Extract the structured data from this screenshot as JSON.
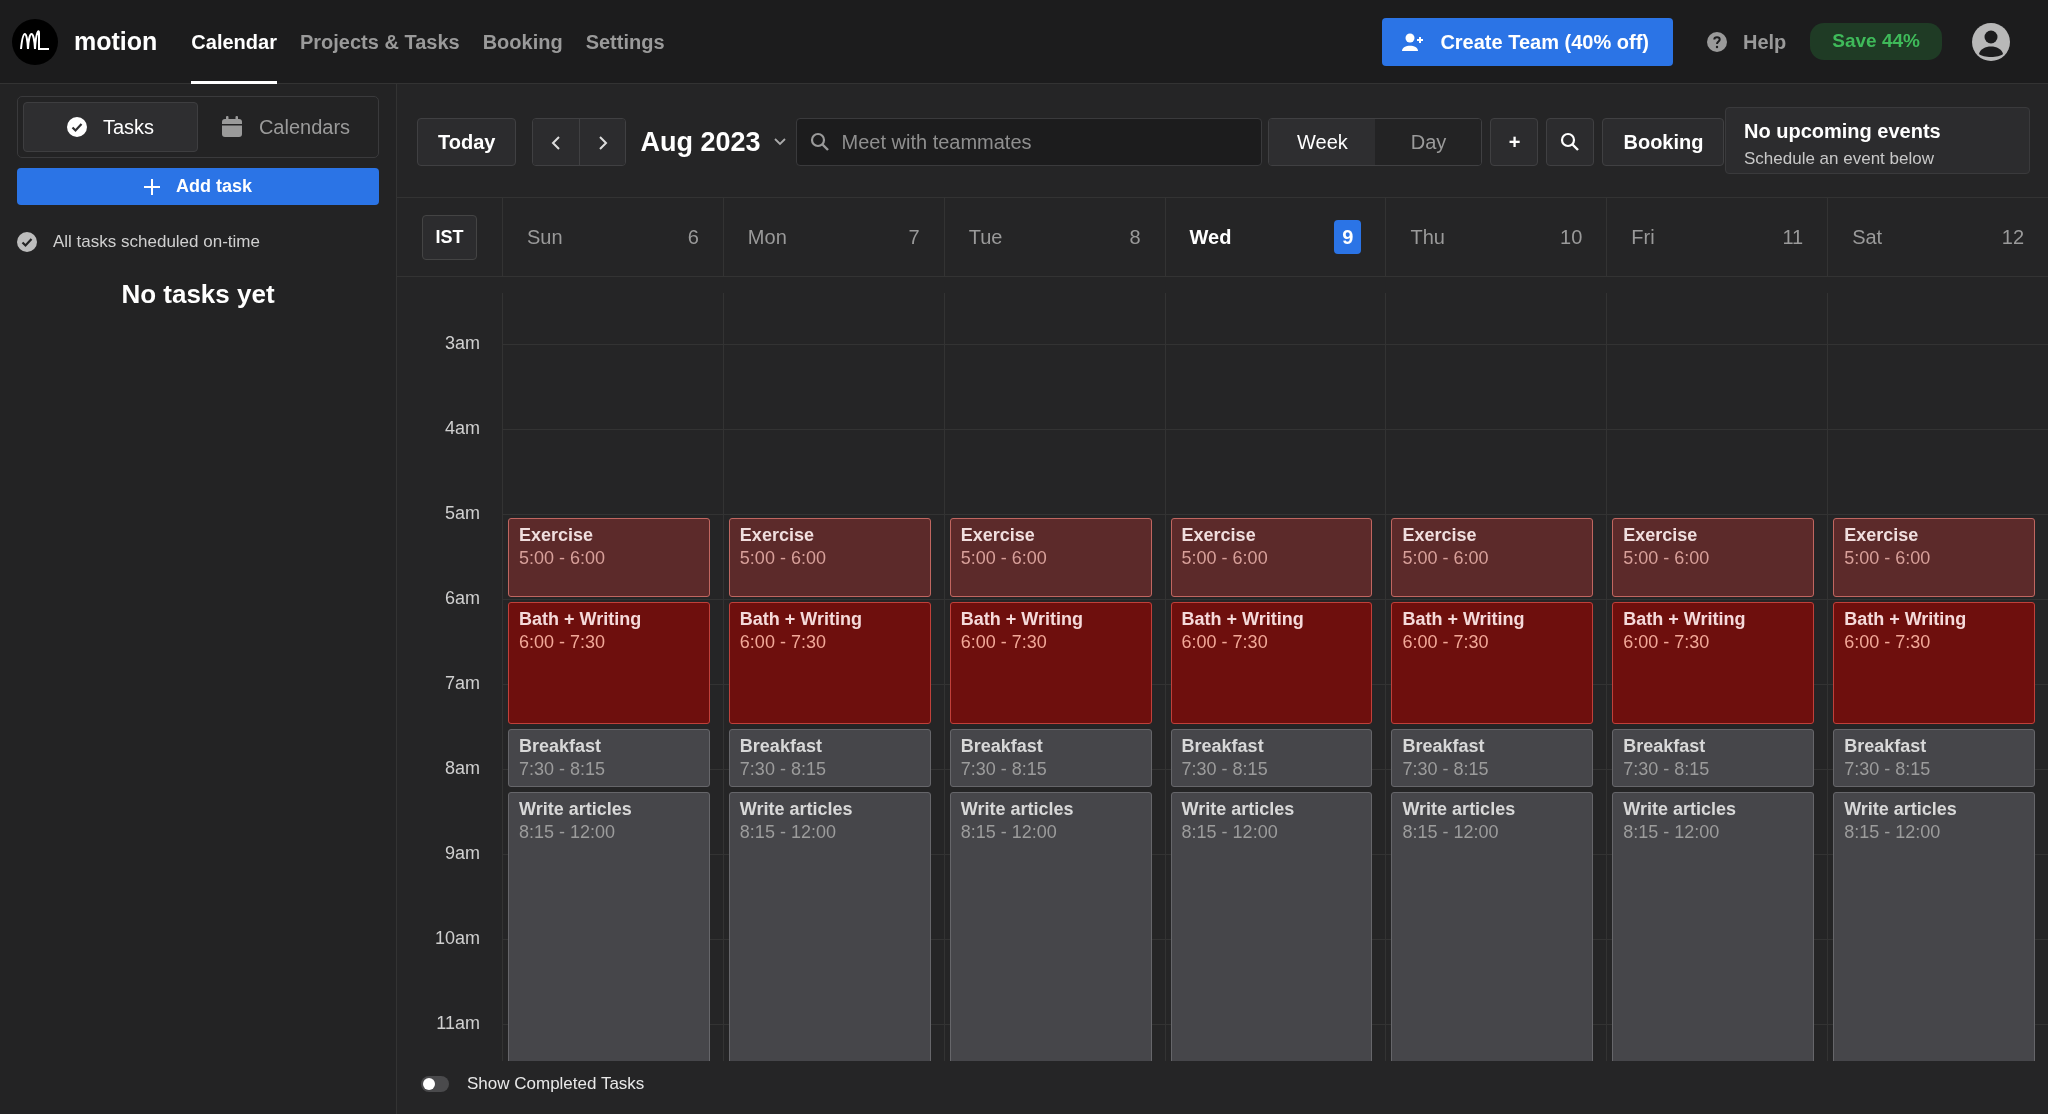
{
  "app": {
    "name": "motion"
  },
  "nav": [
    {
      "label": "Calendar",
      "selected": true
    },
    {
      "label": "Projects & Tasks",
      "selected": false
    },
    {
      "label": "Booking",
      "selected": false
    },
    {
      "label": "Settings",
      "selected": false
    }
  ],
  "header_actions": {
    "create_team": "Create Team (40% off)",
    "help": "Help",
    "save_badge": "Save 44%"
  },
  "sidebar": {
    "tabs": [
      {
        "label": "Tasks",
        "selected": true
      },
      {
        "label": "Calendars",
        "selected": false
      }
    ],
    "add_task": "Add task",
    "status": "All tasks scheduled on-time",
    "empty": "No tasks yet"
  },
  "toolbar": {
    "today": "Today",
    "month": "Aug 2023",
    "search": {
      "placeholder": "Meet with teammates"
    },
    "views": [
      {
        "label": "Week",
        "selected": true
      },
      {
        "label": "Day",
        "selected": false
      }
    ],
    "add": "+",
    "booking": "Booking",
    "upcoming": {
      "title": "No upcoming events",
      "subtitle": "Schedule an event below"
    }
  },
  "timezone": "IST",
  "hours": [
    "3am",
    "4am",
    "5am",
    "6am",
    "7am",
    "8am",
    "9am",
    "10am",
    "11am"
  ],
  "days": [
    {
      "name": "Sun",
      "date": "6",
      "today": false,
      "events": [
        {
          "title": "Exercise",
          "time": "5:00 - 6:00",
          "kind": "hour",
          "color": "#5c2a2a"
        },
        {
          "title": "Bath + Writing",
          "time": "6:00 - 7:30",
          "kind": "ninety",
          "color": "#6e0f0d"
        },
        {
          "title": "Breakfast",
          "time": "7:30 - 8:15",
          "kind": "short",
          "color": "#46464a"
        },
        {
          "title": "Write articles",
          "time": "8:15 - 12:00",
          "kind": "long",
          "color": "#46464a"
        }
      ]
    },
    {
      "name": "Mon",
      "date": "7",
      "today": false,
      "events": [
        {
          "title": "Exercise",
          "time": "5:00 - 6:00",
          "kind": "hour",
          "color": "#5c2a2a"
        },
        {
          "title": "Bath + Writing",
          "time": "6:00 - 7:30",
          "kind": "ninety",
          "color": "#6e0f0d"
        },
        {
          "title": "Breakfast",
          "time": "7:30 - 8:15",
          "kind": "short",
          "color": "#46464a"
        },
        {
          "title": "Write articles",
          "time": "8:15 - 12:00",
          "kind": "long",
          "color": "#46464a"
        }
      ]
    },
    {
      "name": "Tue",
      "date": "8",
      "today": false,
      "events": [
        {
          "title": "Exercise",
          "time": "5:00 - 6:00",
          "kind": "hour",
          "color": "#5c2a2a"
        },
        {
          "title": "Bath + Writing",
          "time": "6:00 - 7:30",
          "kind": "ninety",
          "color": "#6e0f0d"
        },
        {
          "title": "Breakfast",
          "time": "7:30 - 8:15",
          "kind": "short",
          "color": "#46464a"
        },
        {
          "title": "Write articles",
          "time": "8:15 - 12:00",
          "kind": "long",
          "color": "#46464a"
        }
      ]
    },
    {
      "name": "Wed",
      "date": "9",
      "today": true,
      "events": [
        {
          "title": "Exercise",
          "time": "5:00 - 6:00",
          "kind": "hour",
          "color": "#5c2a2a"
        },
        {
          "title": "Bath + Writing",
          "time": "6:00 - 7:30",
          "kind": "ninety",
          "color": "#6e0f0d"
        },
        {
          "title": "Breakfast",
          "time": "7:30 - 8:15",
          "kind": "short",
          "color": "#46464a"
        },
        {
          "title": "Write articles",
          "time": "8:15 - 12:00",
          "kind": "long",
          "color": "#46464a"
        }
      ]
    },
    {
      "name": "Thu",
      "date": "10",
      "today": false,
      "events": [
        {
          "title": "Exercise",
          "time": "5:00 - 6:00",
          "kind": "hour",
          "color": "#5c2a2a"
        },
        {
          "title": "Bath + Writing",
          "time": "6:00 - 7:30",
          "kind": "ninety",
          "color": "#6e0f0d"
        },
        {
          "title": "Breakfast",
          "time": "7:30 - 8:15",
          "kind": "short",
          "color": "#46464a"
        },
        {
          "title": "Write articles",
          "time": "8:15 - 12:00",
          "kind": "long",
          "color": "#46464a"
        }
      ]
    },
    {
      "name": "Fri",
      "date": "11",
      "today": false,
      "events": [
        {
          "title": "Exercise",
          "time": "5:00 - 6:00",
          "kind": "hour",
          "color": "#5c2a2a"
        },
        {
          "title": "Bath + Writing",
          "time": "6:00 - 7:30",
          "kind": "ninety",
          "color": "#6e0f0d"
        },
        {
          "title": "Breakfast",
          "time": "7:30 - 8:15",
          "kind": "short",
          "color": "#46464a"
        },
        {
          "title": "Write articles",
          "time": "8:15 - 12:00",
          "kind": "long",
          "color": "#46464a"
        }
      ]
    },
    {
      "name": "Sat",
      "date": "12",
      "today": false,
      "events": [
        {
          "title": "Exercise",
          "time": "5:00 - 6:00",
          "kind": "hour",
          "color": "#5c2a2a"
        },
        {
          "title": "Bath + Writing",
          "time": "6:00 - 7:30",
          "kind": "ninety",
          "color": "#6e0f0d"
        },
        {
          "title": "Breakfast",
          "time": "7:30 - 8:15",
          "kind": "short",
          "color": "#46464a"
        },
        {
          "title": "Write articles",
          "time": "8:15 - 12:00",
          "kind": "long",
          "color": "#46464a"
        }
      ]
    }
  ],
  "footer": {
    "toggle": {
      "label": "Show Completed Tasks",
      "on": false
    }
  }
}
